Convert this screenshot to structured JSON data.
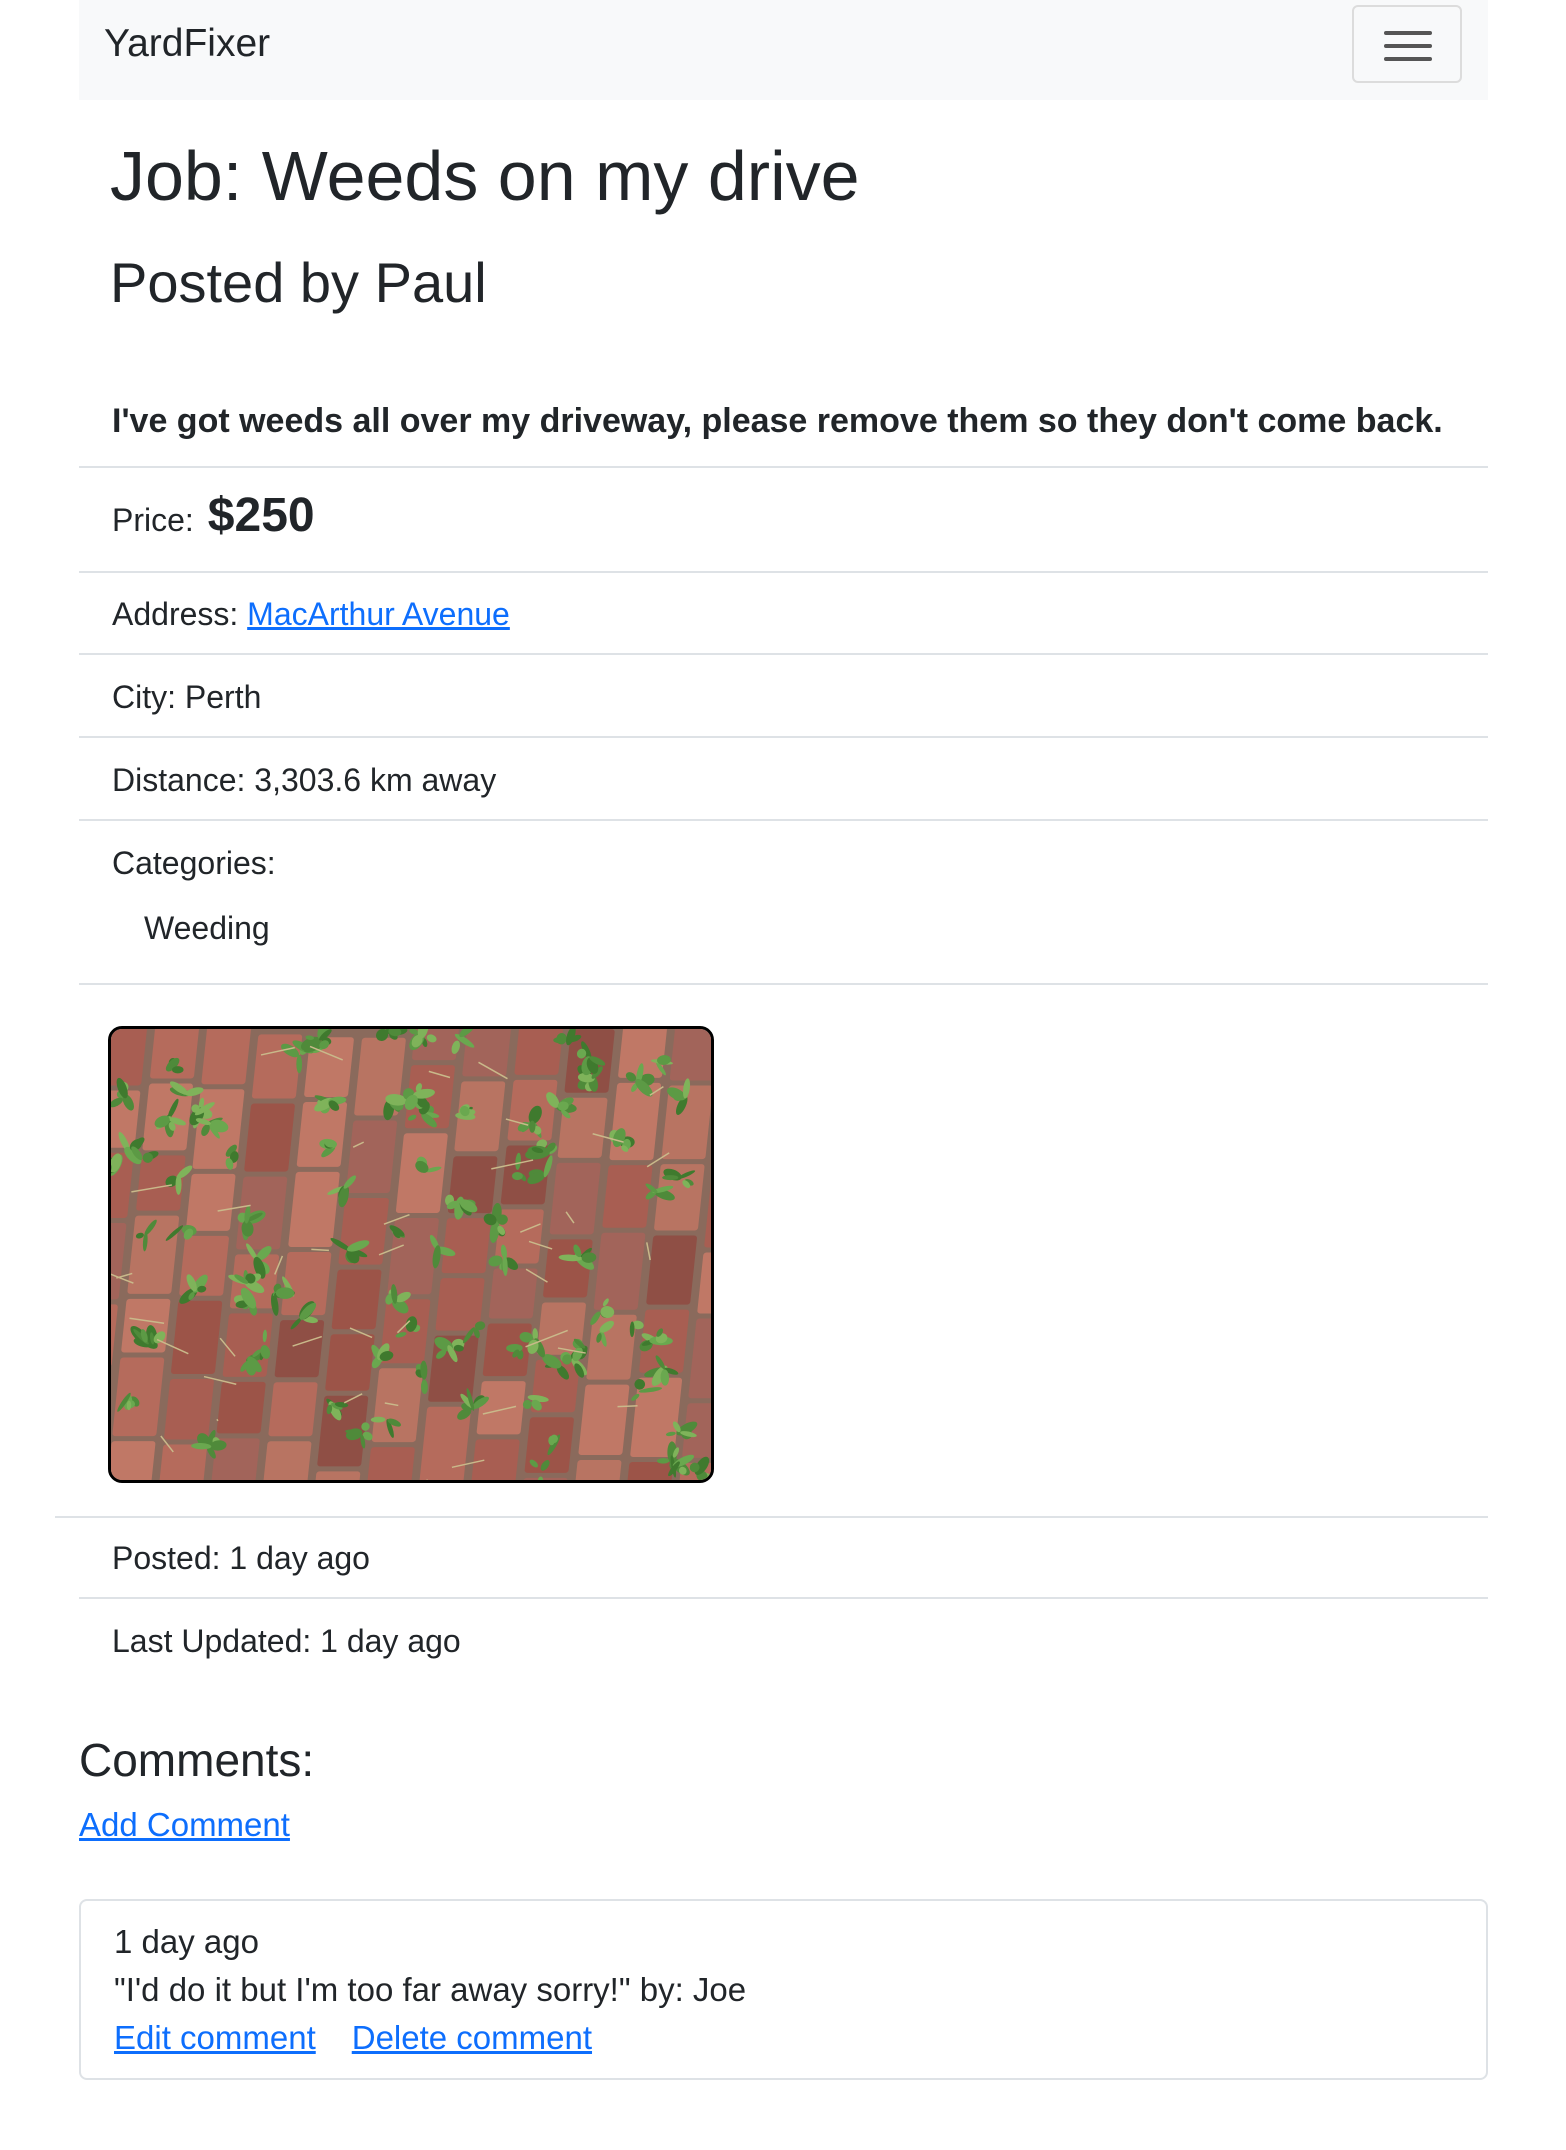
{
  "navbar": {
    "brand": "YardFixer",
    "menu_icon": "hamburger-menu-icon"
  },
  "job": {
    "title": "Job: Weeds on my drive",
    "posted_by": "Posted by Paul",
    "description": "I've got weeds all over my driveway, please remove them so they don't come back.",
    "price_label": "Price:",
    "price_value": "$250",
    "address_label": "Address:",
    "address_value": "MacArthur Avenue",
    "city": "City: Perth",
    "distance": "Distance: 3,303.6 km away",
    "categories_label": "Categories:",
    "categories": [
      "Weeding"
    ],
    "posted": "Posted: 1 day ago",
    "last_updated": "Last Updated: 1 day ago"
  },
  "comments": {
    "heading": "Comments:",
    "add_label": "Add Comment",
    "items": [
      {
        "time": "1 day ago",
        "text": "\"I'd do it but I'm too far away sorry!\" by: Joe",
        "edit_label": "Edit comment",
        "delete_label": "Delete comment"
      }
    ]
  }
}
